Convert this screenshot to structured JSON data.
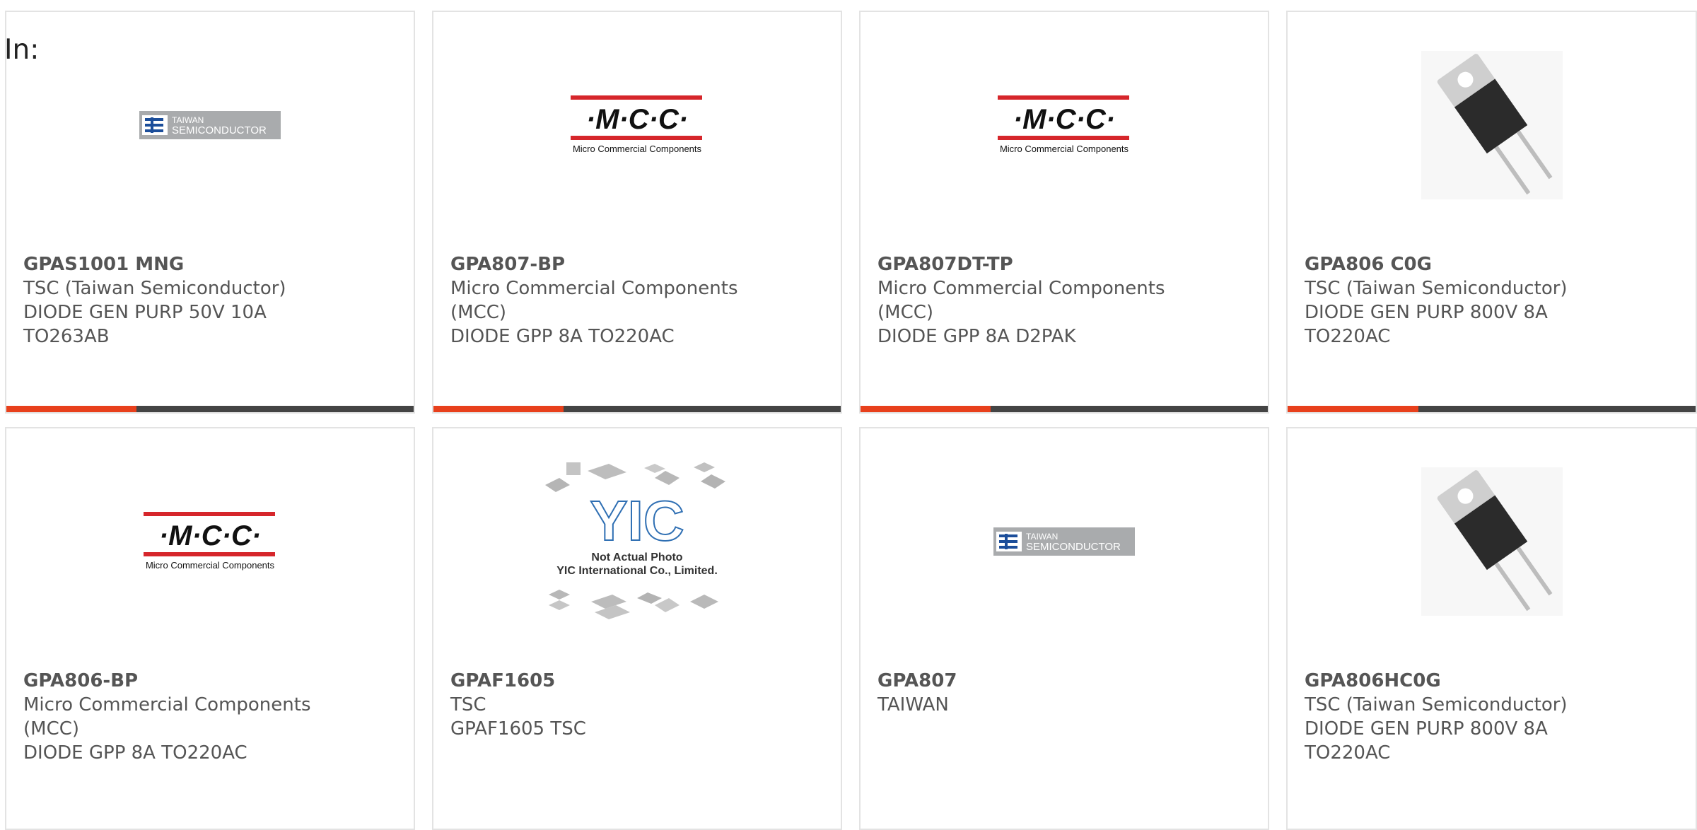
{
  "in_label": "In:",
  "colors": {
    "accent": "#e8401c",
    "bar_dark": "#444444",
    "mcc_red": "#d6262b"
  },
  "logos": {
    "taiwan_top": "TAIWAN",
    "taiwan_bottom": "SEMICONDUCTOR",
    "mcc_mark": "·M·C·C·",
    "mcc_tag": "Micro Commercial Components",
    "yic_line1": "Not Actual Photo",
    "yic_line2": "YIC International Co., Limited."
  },
  "cards": [
    {
      "part": "GPAS1001 MNG",
      "manufacturer": "TSC (Taiwan Semiconductor)",
      "description": "DIODE GEN PURP 50V 10A TO263AB",
      "image": "taiwan-semiconductor-logo"
    },
    {
      "part": "GPA807-BP",
      "manufacturer": "Micro Commercial Components (MCC)",
      "description": "DIODE GPP 8A TO220AC",
      "image": "mcc-logo"
    },
    {
      "part": "GPA807DT-TP",
      "manufacturer": "Micro Commercial Components (MCC)",
      "description": "DIODE GPP 8A D2PAK",
      "image": "mcc-logo"
    },
    {
      "part": "GPA806 C0G",
      "manufacturer": "TSC (Taiwan Semiconductor)",
      "description": "DIODE GEN PURP 800V 8A TO220AC",
      "image": "to220-package-photo"
    },
    {
      "part": "GPA806-BP",
      "manufacturer": "Micro Commercial Components (MCC)",
      "description": "DIODE GPP 8A TO220AC",
      "image": "mcc-logo"
    },
    {
      "part": "GPAF1605",
      "manufacturer": "TSC",
      "description": "GPAF1605 TSC",
      "image": "yic-placeholder"
    },
    {
      "part": "GPA807",
      "manufacturer": "TAIWAN",
      "description": "",
      "image": "taiwan-semiconductor-logo"
    },
    {
      "part": "GPA806HC0G",
      "manufacturer": "TSC (Taiwan Semiconductor)",
      "description": "DIODE GEN PURP 800V 8A TO220AC",
      "image": "to220-package-photo"
    }
  ]
}
